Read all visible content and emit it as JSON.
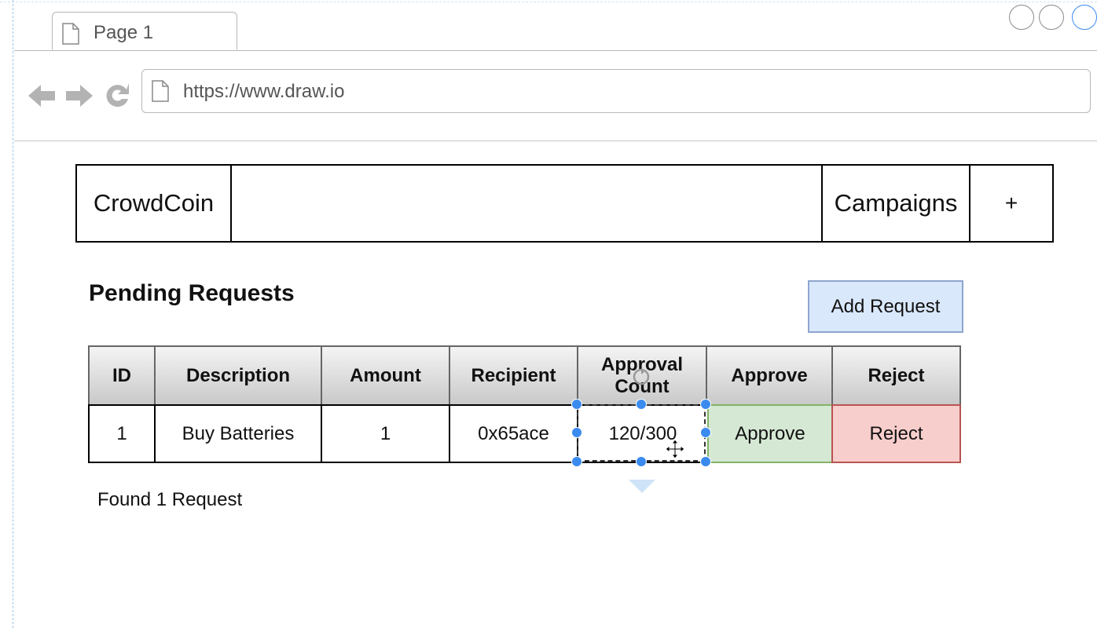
{
  "browser": {
    "tab_label": "Page 1",
    "url": "https://www.draw.io"
  },
  "header": {
    "brand": "CrowdCoin",
    "campaigns": "Campaigns",
    "plus": "+"
  },
  "page": {
    "title": "Pending Requests",
    "add_button": "Add Request",
    "found_text": "Found 1 Request"
  },
  "table": {
    "columns": [
      "ID",
      "Description",
      "Amount",
      "Recipient",
      "Approval Count",
      "Approve",
      "Reject"
    ],
    "rows": [
      {
        "id": "1",
        "description": "Buy Batteries",
        "amount": "1",
        "recipient": "0x65ace",
        "approval_count": "120/300",
        "approve": "Approve",
        "reject": "Reject"
      }
    ]
  },
  "colors": {
    "approve_fill": "#d5e8d4",
    "approve_stroke": "#82b366",
    "reject_fill": "#f8cecc",
    "reject_stroke": "#b85450",
    "add_button_fill": "#dae8fc",
    "selection_handle": "#3b8bef"
  },
  "icons": {
    "back": "arrow-left-icon",
    "forward": "arrow-right-icon",
    "reload": "reload-icon",
    "page": "page-icon"
  }
}
